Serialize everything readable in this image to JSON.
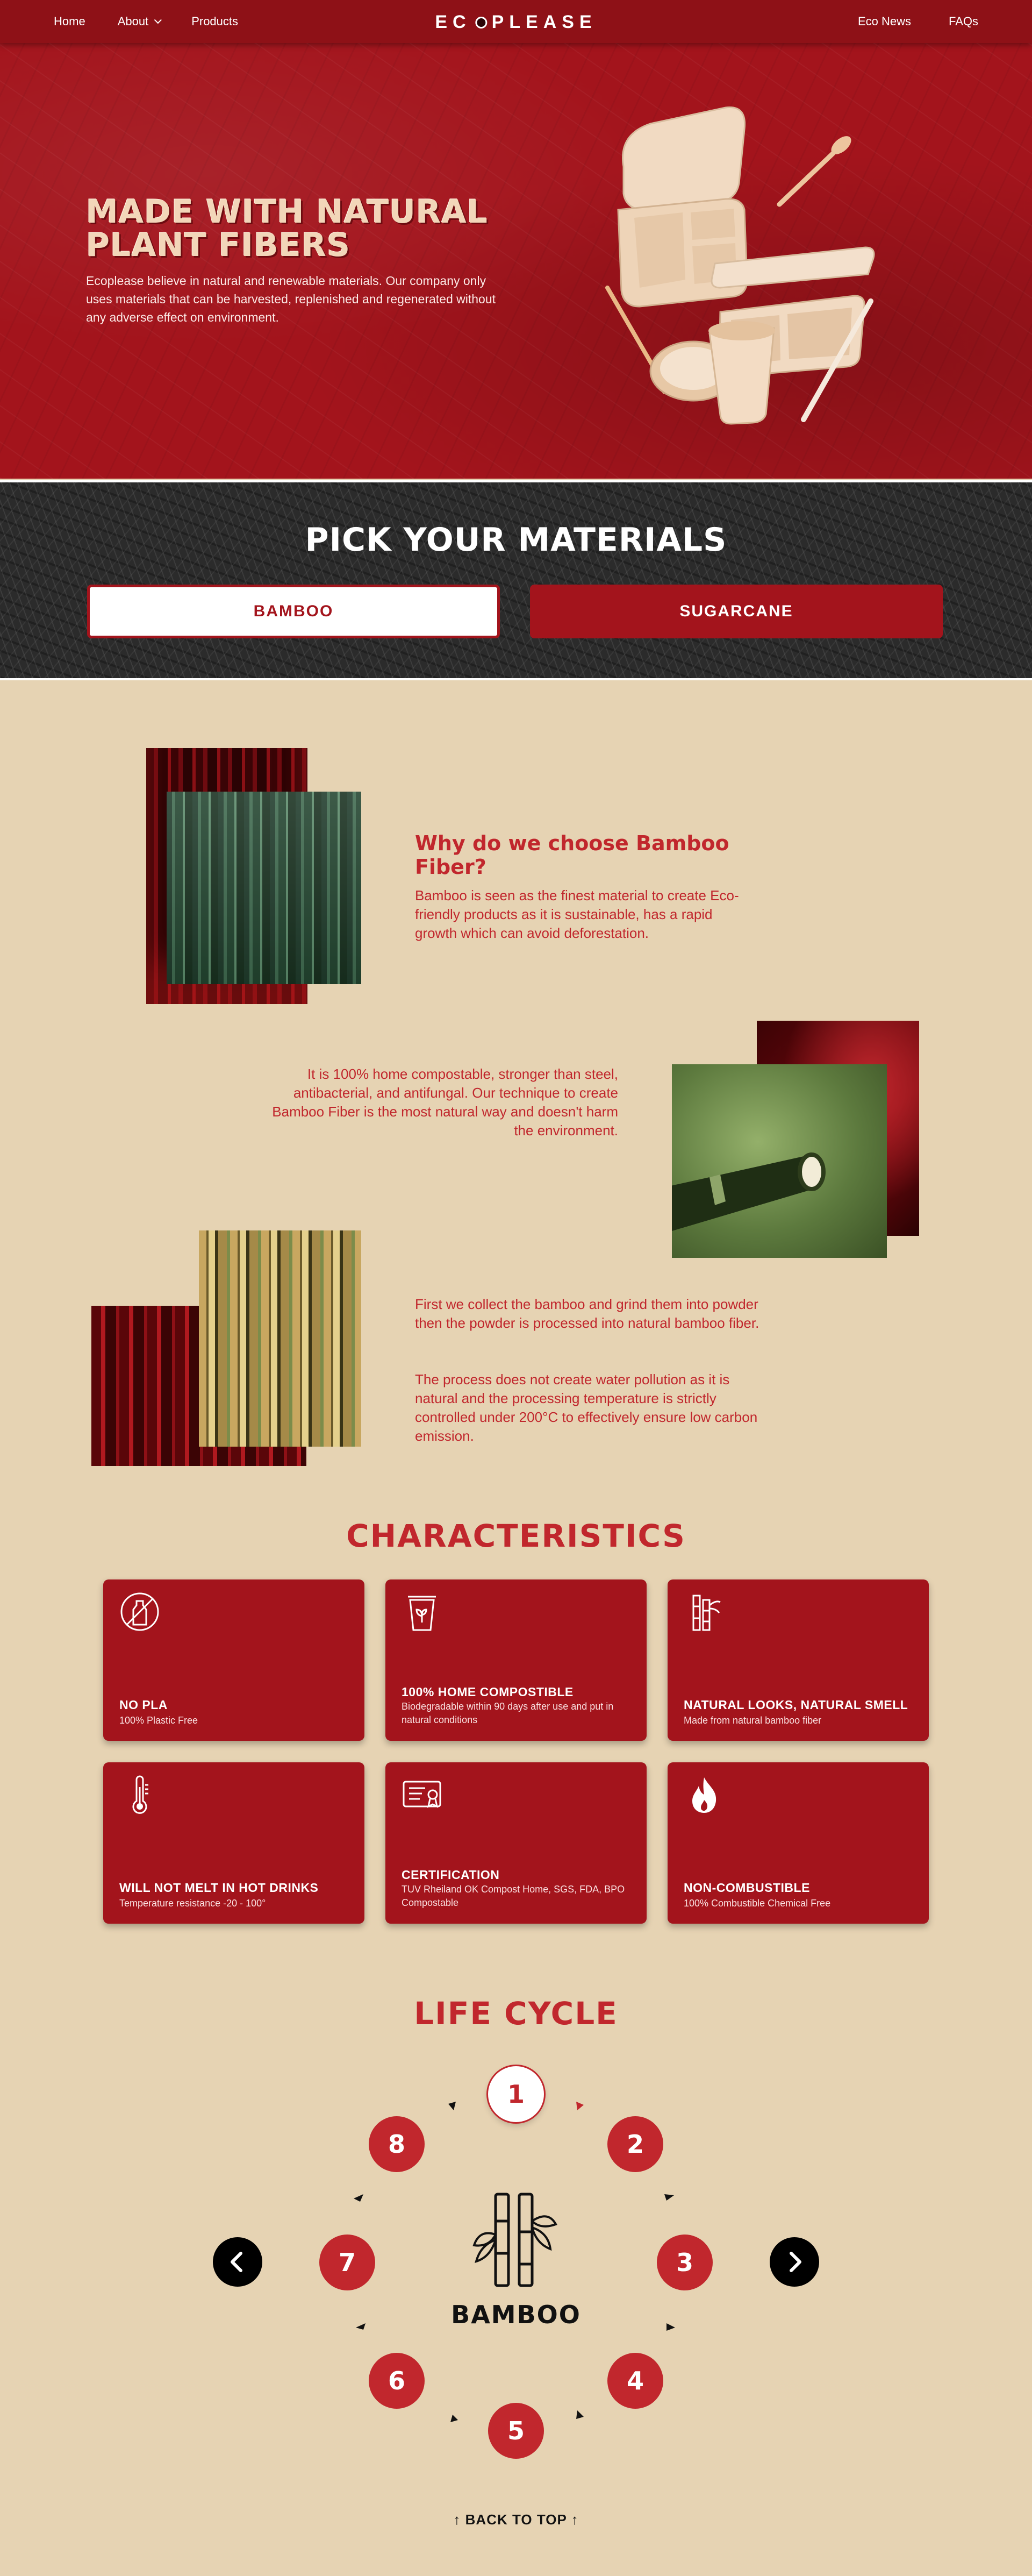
{
  "nav": {
    "home": "Home",
    "about": "About",
    "products": "Products",
    "logo_left": "EC",
    "logo_right": "PLEASE",
    "news": "Eco News",
    "faqs": "FAQs"
  },
  "hero": {
    "title": "MADE WITH NATURAL PLANT FIBERS",
    "body": "Ecoplease believe in natural and renewable materials. Our company only uses materials that can be harvested, replenished and regenerated without any adverse effect on environment."
  },
  "materials": {
    "title": "PICK YOUR MATERIALS",
    "bamboo": "BAMBOO",
    "sugarcane": "SUGARCANE"
  },
  "about": {
    "why_title": "Why do we choose Bamboo Fiber?",
    "why_text": "Bamboo is seen as the finest material to create Eco-friendly products as it is sustainable, has a rapid growth which can avoid deforestation.",
    "compost_text": "It is 100% home compostable, stronger than steel, antibacterial, and antifungal. Our technique to create Bamboo Fiber is the most natural way and doesn't harm the environment.",
    "process_text_1": "First we collect the bamboo and grind them into powder then the powder is processed into natural bamboo fiber.",
    "process_text_2": "The process does not create water pollution as it is natural and the processing temperature is strictly controlled under 200°C to effectively ensure low carbon emission."
  },
  "characteristics": {
    "title": "CHARACTERISTICS",
    "cards": [
      {
        "icon": "no-plastic-bottle-icon",
        "title": "NO PLA",
        "desc": "100% Plastic Free"
      },
      {
        "icon": "compost-bin-icon",
        "title": "100% HOME COMPOSTIBLE",
        "desc": "Biodegradable within 90 days after use and put in natural conditions"
      },
      {
        "icon": "bamboo-stalk-icon",
        "title": "NATURAL LOOKS, NATURAL SMELL",
        "desc": "Made from natural bamboo fiber"
      },
      {
        "icon": "thermometer-icon",
        "title": "WILL NOT MELT IN HOT DRINKS",
        "desc": "Temperature resistance -20 - 100°"
      },
      {
        "icon": "certificate-icon",
        "title": "CERTIFICATION",
        "desc": "TUV Rheiland OK Compost Home, SGS, FDA, BPO Compostable"
      },
      {
        "icon": "flame-icon",
        "title": "NON-COMBUSTIBLE",
        "desc": "100% Combustible Chemical Free"
      }
    ]
  },
  "lifecycle": {
    "title": "LIFE CYCLE",
    "steps": [
      "1",
      "2",
      "3",
      "4",
      "5",
      "6",
      "7",
      "8"
    ],
    "active_step": "1",
    "center_label": "BAMBOO",
    "center_icon": "bamboo-icon"
  },
  "footer": {
    "back_to_top": "↑ BACK TO TOP ↑"
  },
  "colors": {
    "brand_red": "#a3141c",
    "text_red": "#c1272d",
    "beige": "#e6d3b3"
  }
}
